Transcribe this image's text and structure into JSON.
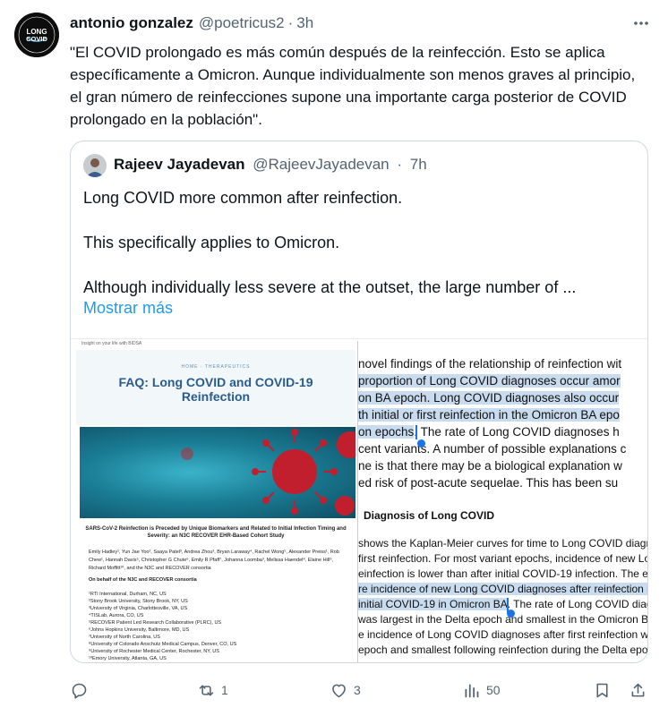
{
  "tweet": {
    "author_name": "antonio gonzalez",
    "author_handle": "@poetricus2",
    "separator": "·",
    "time": "3h",
    "avatar_lines": [
      "LONG",
      "COVID",
      "LONG COVID",
      "AWARENESS"
    ],
    "text": "\"El COVID prolongado es más común después de la reinfección. Esto se aplica específicamente a Omicron. Aunque individualmente son menos graves al principio, el gran número de reinfecciones supone una importante carga posterior de COVID prolongado en la población\".",
    "more_icon": "more-horizontal-icon"
  },
  "quote": {
    "author_name": "Rajeev Jayadevan",
    "author_handle": "@RajeevJayadevan",
    "separator": "·",
    "time": "7h",
    "paragraphs": [
      "Long COVID more common after reinfection.",
      "This specifically applies to Omicron.",
      "Although individually less severe at the outset, the large number of ..."
    ],
    "show_more": "Mostrar más"
  },
  "media": {
    "left": {
      "top_banner": "Insight on your life with BIDSA",
      "crumb": "HOME · THERAPEUTICS",
      "faq_title_line1": "FAQ: Long COVID and COVID-19",
      "faq_title_line2": "Reinfection",
      "paper_title": "SARS-CoV-2 Reinfection is Preceded by Unique Biomarkers and Related to Initial Infection Timing and Severity: an N3C RECOVER EHR-Based Cohort Study",
      "authors": "Emily Hadley¹, Yun Jae Yoo², Saaya Patel³, Andrea Zhou³, Bryan Laraway⁴, Rachel Wong⁵, Alexander Preiss¹, Rob Chew¹, Hannah Davis⁵, Christopher G Chute⁶, Emily R Pfaff⁷, Johanna Loomba³, Melissa Haendel⁸, Elaine Hill⁹, Richard Moffitt¹⁰, and the N3C and RECOVER consortia",
      "consortium": "On behalf of the N3C and RECOVER consortia",
      "affiliations": [
        "¹RTI International, Durham, NC, US",
        "²Stony Brook University, Stony Brook, NY, US",
        "³University of Virginia, Charlottesville, VA, US",
        "⁴TISLab, Aurora, CO, US",
        "⁵RECOVER Patient Led Research Collaborative (PLRC), US",
        "⁶Johns Hopkins University, Baltimore, MD, US",
        "⁷University of North Carolina, US",
        "⁸University of Colorado Anschutz Medical Campus, Denver, CO, US",
        "⁹University of Rochester Medical Center, Rochester, NY, US",
        "¹⁰Emory University, Atlanta, GA, US"
      ]
    },
    "right": {
      "lines": [
        {
          "text": "novel findings of the relationship of reinfection wit",
          "hl": false
        },
        {
          "text": "proportion of Long COVID diagnoses occur amor",
          "hl": true
        },
        {
          "text": "on BA epoch. Long COVID diagnoses also occur",
          "hl": true
        },
        {
          "text": "th initial or first reinfection in the Omicron BA epo",
          "hl": true
        },
        {
          "text_hl": "on epochs",
          "text_rest": ". The rate of Long COVID diagnoses h"
        },
        {
          "text": "cent variants. A number of possible explanations c",
          "hl": false
        },
        {
          "text": "ne is that there may be a biological explanation w",
          "hl": false
        },
        {
          "text": "ed risk of post-acute sequelae. This has been su",
          "hl": false
        }
      ],
      "heading": "Diagnosis of Long COVID",
      "lines2": [
        {
          "text": "shows the Kaplan-Meier curves for time to Long COVID diagr",
          "hl": false
        },
        {
          "text": "first reinfection. For most variant epochs, incidence of new Lor",
          "hl": false
        },
        {
          "text": "einfection is lower than after initial COVID-19 infection. The ex",
          "hl": false
        },
        {
          "text": "re incidence of new Long COVID diagnoses after reinfection in",
          "hl": true
        },
        {
          "text_hl": "initial COVID-19 in Omicron BA",
          "text_rest": ". The rate of Long COVID diag"
        },
        {
          "text": "was largest in the Delta epoch and smallest in the Omicron BA",
          "hl": false
        },
        {
          "text": "e incidence of Long COVID diagnoses after first reinfection wh",
          "hl": false
        },
        {
          "text": "epoch and smallest following reinfection during the Delta epoc",
          "hl": false
        }
      ]
    }
  },
  "actions": {
    "reply_icon": "reply-icon",
    "retweet_icon": "retweet-icon",
    "retweet_count": "1",
    "like_icon": "heart-icon",
    "like_count": "3",
    "views_icon": "views-icon",
    "views_count": "50",
    "bookmark_icon": "bookmark-icon",
    "share_icon": "share-icon"
  }
}
